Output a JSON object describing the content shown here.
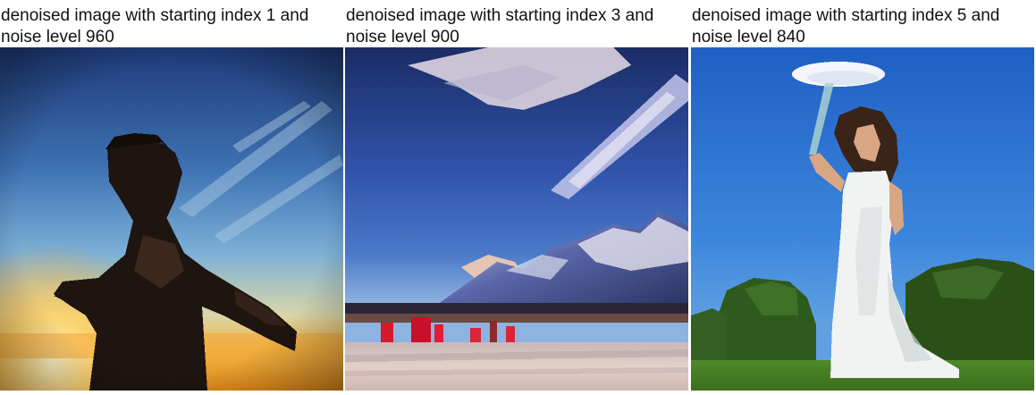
{
  "panels": [
    {
      "caption": "denoised image with starting index 1 and noise level 960",
      "subject": "shirtless man silhouette against sunset sky"
    },
    {
      "caption": "denoised image with starting index 3 and noise level 900",
      "subject": "mountain range over sandy beach with blue sky"
    },
    {
      "caption": "denoised image with starting index 5 and noise level 840",
      "subject": "woman in white dress holding parasol on grass field"
    }
  ]
}
